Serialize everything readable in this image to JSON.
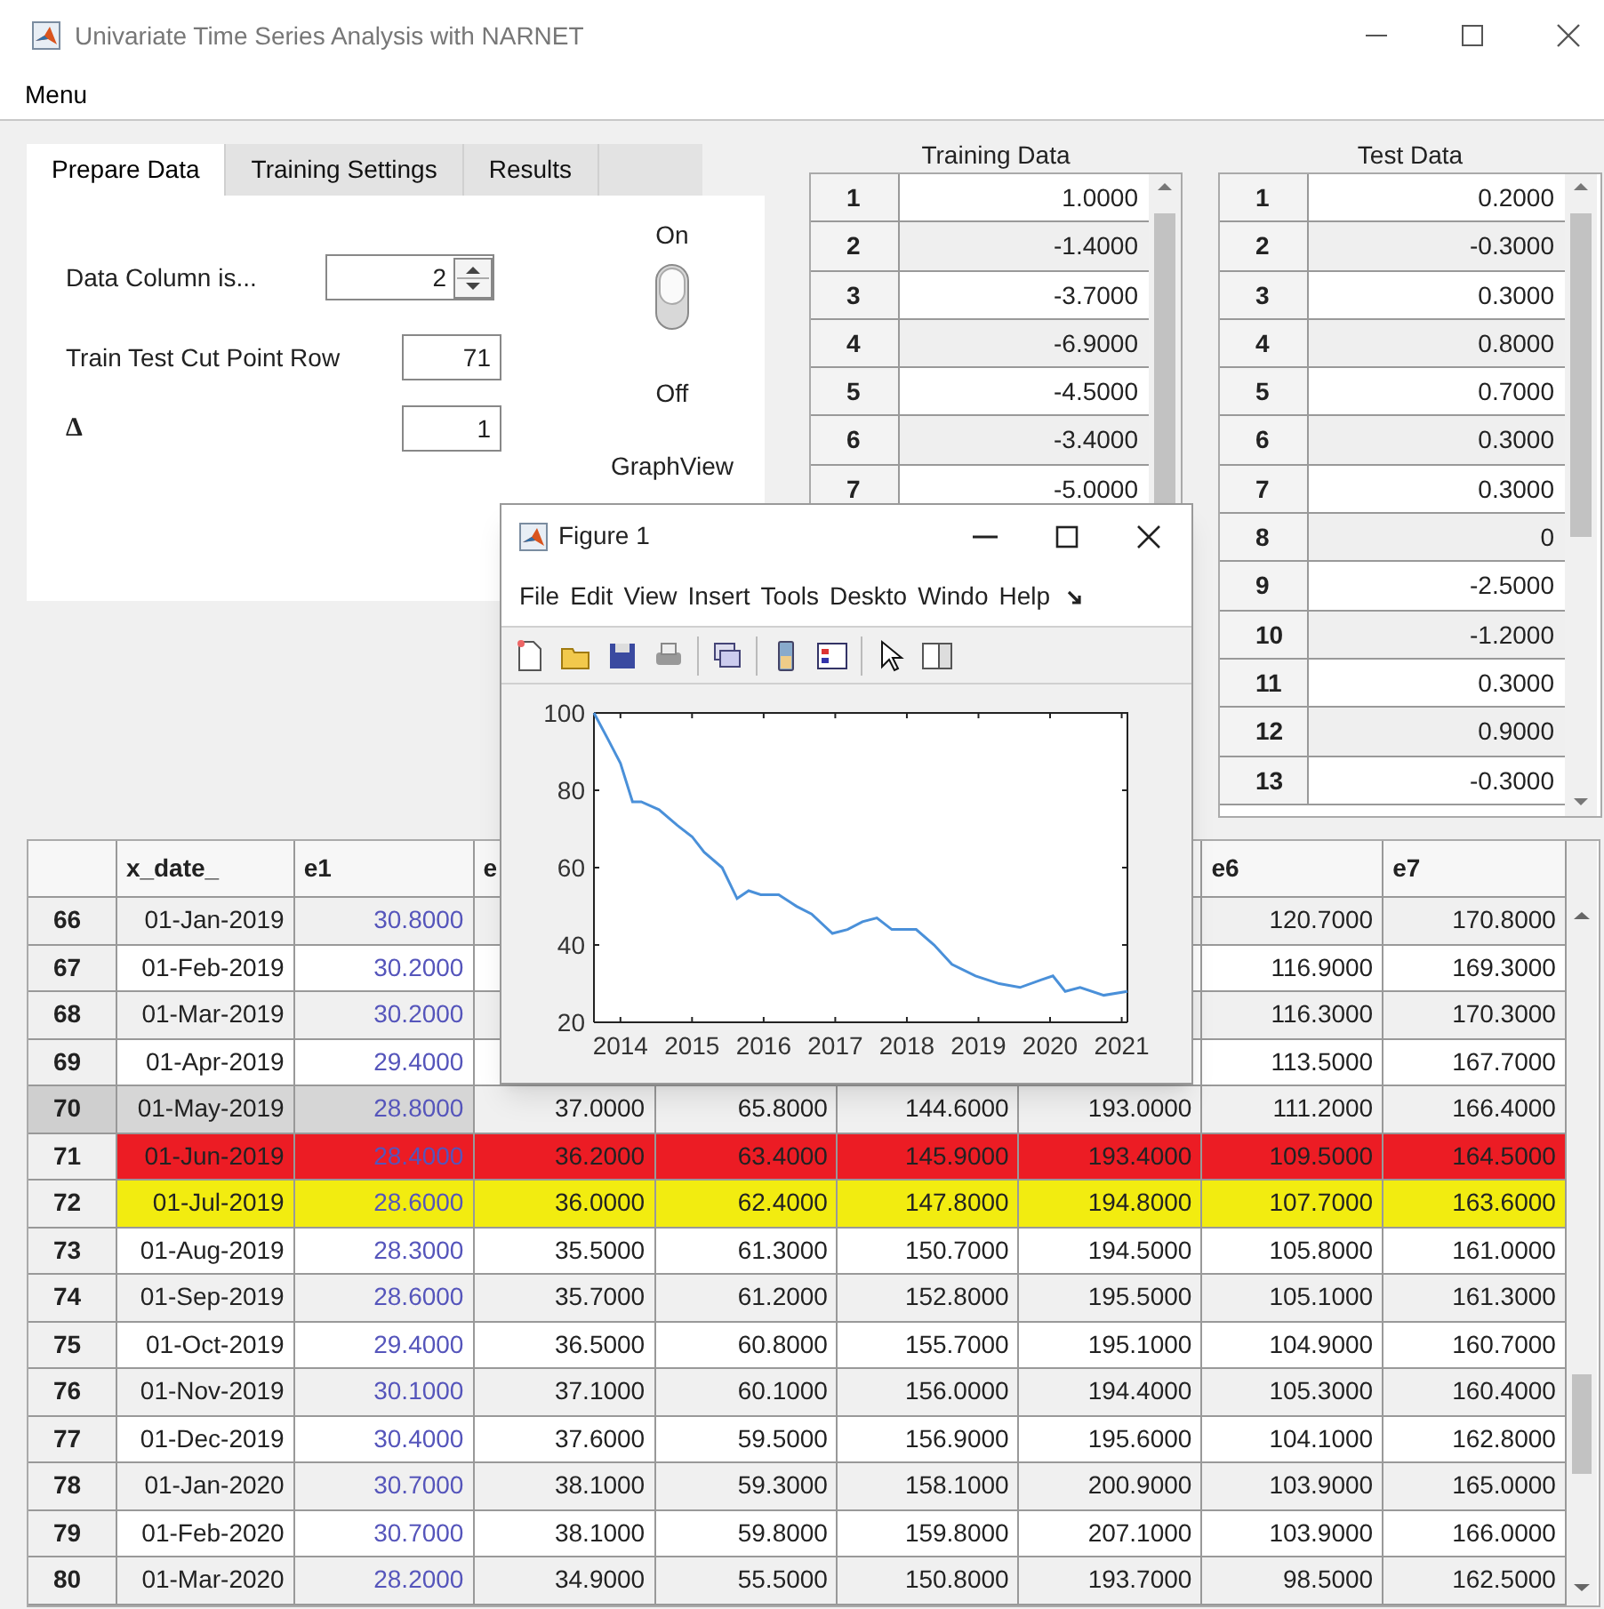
{
  "window": {
    "title": "Univariate Time Series Analysis with NARNET"
  },
  "menu_bar": [
    "Menu"
  ],
  "tabs": [
    {
      "label": "Prepare Data",
      "selected": true
    },
    {
      "label": "Training Settings",
      "selected": false
    },
    {
      "label": "Results",
      "selected": false
    }
  ],
  "prepare_data": {
    "data_column": {
      "label": "Data Column is...",
      "value": "2"
    },
    "cut_point": {
      "label": "Train Test Cut Point Row",
      "value": "71"
    },
    "delta": {
      "label": "Δ",
      "value": "1"
    },
    "graph_switch": {
      "on_label": "On",
      "off_label": "Off",
      "label": "GraphView",
      "on": true
    }
  },
  "training_data": {
    "title": "Training Data",
    "rows": [
      [
        "1",
        "1.0000"
      ],
      [
        "2",
        "-1.4000"
      ],
      [
        "3",
        "-3.7000"
      ],
      [
        "4",
        "-6.9000"
      ],
      [
        "5",
        "-4.5000"
      ],
      [
        "6",
        "-3.4000"
      ],
      [
        "7",
        "-5.0000"
      ]
    ]
  },
  "test_data": {
    "title": "Test Data",
    "rows": [
      [
        "1",
        "0.2000"
      ],
      [
        "2",
        "-0.3000"
      ],
      [
        "3",
        "0.3000"
      ],
      [
        "4",
        "0.8000"
      ],
      [
        "5",
        "0.7000"
      ],
      [
        "6",
        "0.3000"
      ],
      [
        "7",
        "0.3000"
      ],
      [
        "8",
        "0"
      ],
      [
        "9",
        "-2.5000"
      ],
      [
        "10",
        "-1.2000"
      ],
      [
        "11",
        "0.3000"
      ],
      [
        "12",
        "0.9000"
      ],
      [
        "13",
        "-0.3000"
      ]
    ]
  },
  "main_table": {
    "columns": [
      "x_date_",
      "e1",
      "e",
      null,
      null,
      null,
      "e6",
      "e7"
    ],
    "rows": [
      {
        "row": "66",
        "selected": false,
        "cells": [
          "01-Jan-2019",
          "30.8000",
          null,
          null,
          null,
          null,
          "120.7000",
          "170.8000"
        ]
      },
      {
        "row": "67",
        "selected": false,
        "cells": [
          "01-Feb-2019",
          "30.2000",
          null,
          null,
          null,
          null,
          "116.9000",
          "169.3000"
        ]
      },
      {
        "row": "68",
        "selected": false,
        "cells": [
          "01-Mar-2019",
          "30.2000",
          null,
          null,
          null,
          null,
          "116.3000",
          "170.3000"
        ]
      },
      {
        "row": "69",
        "selected": false,
        "cells": [
          "01-Apr-2019",
          "29.4000",
          null,
          null,
          null,
          null,
          "113.5000",
          "167.7000"
        ]
      },
      {
        "row": "70",
        "selected": true,
        "cells": [
          "01-May-2019",
          "28.8000",
          "37.0000",
          "65.8000",
          "144.6000",
          "193.0000",
          "111.2000",
          "166.4000"
        ]
      },
      {
        "row": "71",
        "selected": false,
        "color": "#ec1c24",
        "cells": [
          "01-Jun-2019",
          "28.4000",
          "36.2000",
          "63.4000",
          "145.9000",
          "193.4000",
          "109.5000",
          "164.5000"
        ]
      },
      {
        "row": "72",
        "selected": false,
        "color": "#f2ec10",
        "cells": [
          "01-Jul-2019",
          "28.6000",
          "36.0000",
          "62.4000",
          "147.8000",
          "194.8000",
          "107.7000",
          "163.6000"
        ]
      },
      {
        "row": "73",
        "selected": false,
        "cells": [
          "01-Aug-2019",
          "28.3000",
          "35.5000",
          "61.3000",
          "150.7000",
          "194.5000",
          "105.8000",
          "161.0000"
        ]
      },
      {
        "row": "74",
        "selected": false,
        "cells": [
          "01-Sep-2019",
          "28.6000",
          "35.7000",
          "61.2000",
          "152.8000",
          "195.5000",
          "105.1000",
          "161.3000"
        ]
      },
      {
        "row": "75",
        "selected": false,
        "cells": [
          "01-Oct-2019",
          "29.4000",
          "36.5000",
          "60.8000",
          "155.7000",
          "195.1000",
          "104.9000",
          "160.7000"
        ]
      },
      {
        "row": "76",
        "selected": false,
        "cells": [
          "01-Nov-2019",
          "30.1000",
          "37.1000",
          "60.1000",
          "156.0000",
          "194.4000",
          "105.3000",
          "160.4000"
        ]
      },
      {
        "row": "77",
        "selected": false,
        "cells": [
          "01-Dec-2019",
          "30.4000",
          "37.6000",
          "59.5000",
          "156.9000",
          "195.6000",
          "104.1000",
          "162.8000"
        ]
      },
      {
        "row": "78",
        "selected": false,
        "cells": [
          "01-Jan-2020",
          "30.7000",
          "38.1000",
          "59.3000",
          "158.1000",
          "200.9000",
          "103.9000",
          "165.0000"
        ]
      },
      {
        "row": "79",
        "selected": false,
        "cells": [
          "01-Feb-2020",
          "30.7000",
          "38.1000",
          "59.8000",
          "159.8000",
          "207.1000",
          "103.9000",
          "166.0000"
        ]
      },
      {
        "row": "80",
        "selected": false,
        "cells": [
          "01-Mar-2020",
          "28.2000",
          "34.9000",
          "55.5000",
          "150.8000",
          "193.7000",
          "98.5000",
          "162.5000"
        ]
      }
    ]
  },
  "figure": {
    "title": "Figure 1",
    "menu": [
      "File",
      "Edit",
      "View",
      "Insert",
      "Tools",
      "Deskto",
      "Windo",
      "Help"
    ],
    "chart_data": {
      "type": "line",
      "x": [
        2013.63,
        2013.83,
        2014.0,
        2014.17,
        2014.29,
        2014.54,
        2014.79,
        2015.0,
        2015.17,
        2015.42,
        2015.63,
        2015.79,
        2015.96,
        2016.21,
        2016.46,
        2016.67,
        2016.96,
        2017.17,
        2017.38,
        2017.58,
        2017.79,
        2018.13,
        2018.38,
        2018.63,
        2018.96,
        2019.29,
        2019.58,
        2019.88,
        2020.04,
        2020.21,
        2020.42,
        2020.75,
        2021.08
      ],
      "series": [
        {
          "color": "#4a90d9",
          "values": [
            100,
            93,
            87,
            77,
            77,
            75,
            71,
            68,
            64,
            60,
            52,
            54,
            53,
            53,
            50,
            48,
            43,
            44,
            46,
            47,
            44,
            44,
            40,
            35,
            32,
            30,
            29,
            31,
            32,
            28,
            29,
            27,
            28
          ]
        }
      ],
      "xlim": [
        2013.63,
        2021.08
      ],
      "ylim": [
        20,
        100
      ],
      "xticks": [
        2014,
        2015,
        2016,
        2017,
        2018,
        2019,
        2020,
        2021
      ],
      "yticks": [
        20,
        40,
        60,
        80,
        100
      ]
    }
  }
}
